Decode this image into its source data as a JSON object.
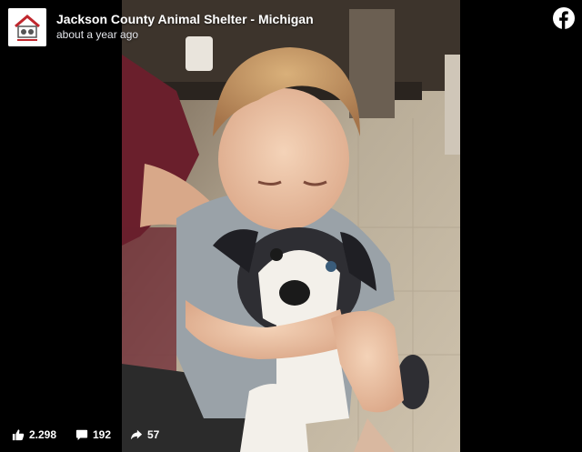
{
  "post": {
    "page_name": "Jackson County Animal Shelter - Michigan",
    "timestamp": "about a year ago"
  },
  "stats": {
    "likes": "2.298",
    "comments": "192",
    "shares": "57"
  },
  "icons": {
    "logo": "shelter-logo-icon",
    "brand": "facebook-icon",
    "like": "thumbs-up-icon",
    "comment": "comment-icon",
    "share": "share-icon"
  },
  "colors": {
    "background": "#000000",
    "text": "#ffffff",
    "subtext": "#e4e6eb",
    "logo_red": "#c0272d"
  }
}
